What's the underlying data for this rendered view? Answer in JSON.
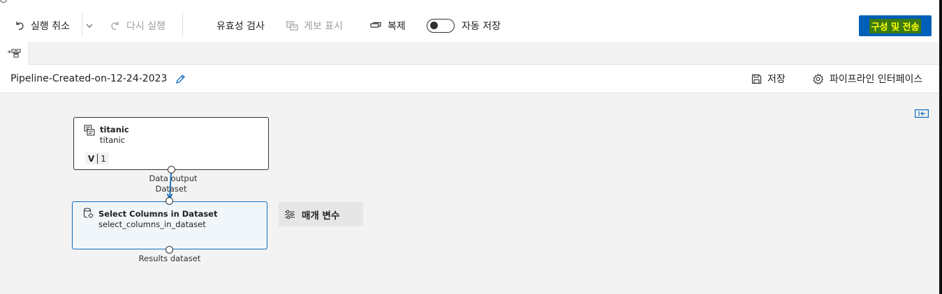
{
  "toolbar": {
    "undo_label": "실행 취소",
    "redo_label": "다시 실행",
    "validate_label": "유효성 검사",
    "publish_label": "게보 표시",
    "clone_label": "복제",
    "autosave_label": "자동 저장",
    "autosave_on": false,
    "submit_label": "구성 및 전송"
  },
  "tabs": [
    {
      "label": "*",
      "active": true
    }
  ],
  "pipeline": {
    "title": "Pipeline-Created-on-12-24-2023",
    "save_label": "저장",
    "interface_label": "파이프라인 인터페이스"
  },
  "nodes": {
    "dataset": {
      "title": "titanic",
      "subtitle": "titanic",
      "version_letter": "V",
      "version_number": "1",
      "output_label_1": "Data output",
      "output_label_2": "Dataset"
    },
    "select_columns": {
      "title": "Select Columns in Dataset",
      "subtitle": "select_columns_in_dataset",
      "output_label": "Results dataset"
    }
  },
  "params_panel": {
    "label": "매개 변수"
  },
  "colors": {
    "accent": "#0f6cbd",
    "submit_bg": "#005fb8",
    "submit_highlight": "#3c7a14",
    "submit_text": "#ffff00"
  }
}
